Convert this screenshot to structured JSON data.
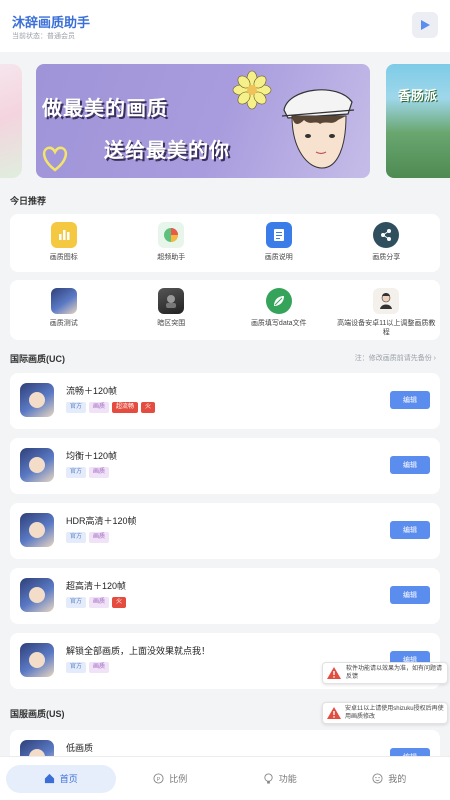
{
  "header": {
    "title": "沐辞画质助手",
    "subtitle": "当前状态：普通会员"
  },
  "banners": [
    {
      "line1": "做最美的画质",
      "line2": "送给最美的你"
    },
    {
      "line1": "香肠派"
    }
  ],
  "recommend": {
    "title": "今日推荐",
    "row1": [
      {
        "label": "画质图标",
        "icon": "bar-chart-icon",
        "color": "#f5c842"
      },
      {
        "label": "超频助手",
        "icon": "pie-chart-icon",
        "color": "#5fc17d"
      },
      {
        "label": "画质说明",
        "icon": "document-icon",
        "color": "#3b7de8"
      },
      {
        "label": "画质分享",
        "icon": "share-icon",
        "color": "#2f4f5f"
      }
    ],
    "row2": [
      {
        "label": "画质测试",
        "icon": "game-avatar-icon"
      },
      {
        "label": "暗区突围",
        "icon": "soldier-avatar-icon"
      },
      {
        "label": "画质填写data文件",
        "icon": "leaf-icon",
        "color": "#35a35a"
      },
      {
        "label": "高端设备安卓11以上调整画质教程",
        "icon": "person-avatar-icon"
      }
    ]
  },
  "intl_section": {
    "title": "国际画质(UC)",
    "right_text": "注：修改画质前请先备份"
  },
  "items": [
    {
      "title": "流畅＋120帧",
      "tags": [
        {
          "text": "官方",
          "kind": "blue"
        },
        {
          "text": "画质",
          "kind": "purple"
        },
        {
          "text": "超流畅",
          "kind": "red"
        },
        {
          "text": "火",
          "kind": "red"
        }
      ],
      "button": "编辑"
    },
    {
      "title": "均衡＋120帧",
      "tags": [
        {
          "text": "官方",
          "kind": "blue"
        },
        {
          "text": "画质",
          "kind": "purple"
        }
      ],
      "button": "编辑"
    },
    {
      "title": "HDR高清＋120帧",
      "tags": [
        {
          "text": "官方",
          "kind": "blue"
        },
        {
          "text": "画质",
          "kind": "purple"
        }
      ],
      "button": "编辑"
    },
    {
      "title": "超高清＋120帧",
      "tags": [
        {
          "text": "官方",
          "kind": "blue"
        },
        {
          "text": "画质",
          "kind": "purple"
        },
        {
          "text": "火",
          "kind": "red"
        }
      ],
      "button": "编辑"
    },
    {
      "title": "解锁全部画质，上面没效果就点我！",
      "tags": [
        {
          "text": "官方",
          "kind": "blue"
        },
        {
          "text": "画质",
          "kind": "purple"
        }
      ],
      "button": "编辑"
    }
  ],
  "us_section": {
    "title": "国服画质(US)"
  },
  "us_items": [
    {
      "title": "低画质",
      "button": "编辑"
    }
  ],
  "toasts": [
    {
      "text": "软件功能请以效果为准，如有问题请反馈"
    },
    {
      "text": "安卓11以上请使用shizuku授权后再使用画质修改"
    }
  ],
  "nav": [
    {
      "label": "首页",
      "icon": "home-icon",
      "active": true
    },
    {
      "label": "比例",
      "icon": "ratio-icon",
      "active": false
    },
    {
      "label": "功能",
      "icon": "bulb-icon",
      "active": false
    },
    {
      "label": "我的",
      "icon": "user-icon",
      "active": false
    }
  ],
  "colors": {
    "accent": "#3b6fd8",
    "button": "#5b8def",
    "background": "#f3f4f6"
  }
}
